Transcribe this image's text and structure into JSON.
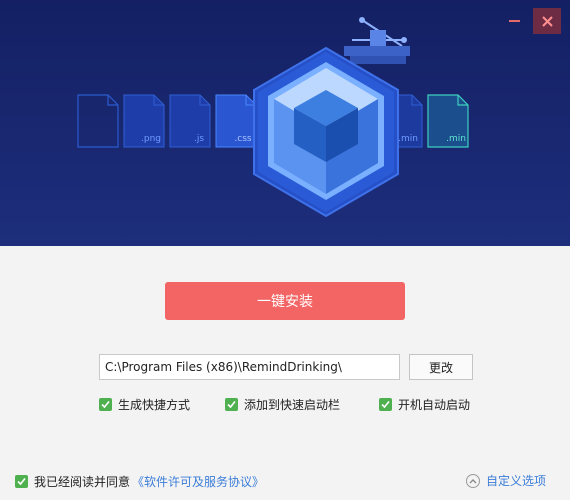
{
  "window": {
    "minimize_icon": "minimize-icon",
    "close_icon": "close-icon",
    "accent_close": "#6e2b44",
    "header_bg": "#18276e"
  },
  "banner": {
    "file_labels": [
      ".png",
      ".js",
      ".css",
      ".min",
      ".min"
    ],
    "logo_icon": "webpack-cube-icon"
  },
  "install": {
    "label": "一键安装",
    "color": "#f36464"
  },
  "path": {
    "value": "C:\\Program Files (x86)\\RemindDrinking\\",
    "change_label": "更改"
  },
  "options": [
    {
      "label": "生成快捷方式",
      "checked": true
    },
    {
      "label": "添加到快速启动栏",
      "checked": true
    },
    {
      "label": "开机自动启动",
      "checked": true
    }
  ],
  "agreement": {
    "prefix": "我已经阅读并同意",
    "link": "《软件许可及服务协议》",
    "checked": true
  },
  "custom": {
    "label": "自定义选项",
    "icon": "chevron-up-icon"
  }
}
